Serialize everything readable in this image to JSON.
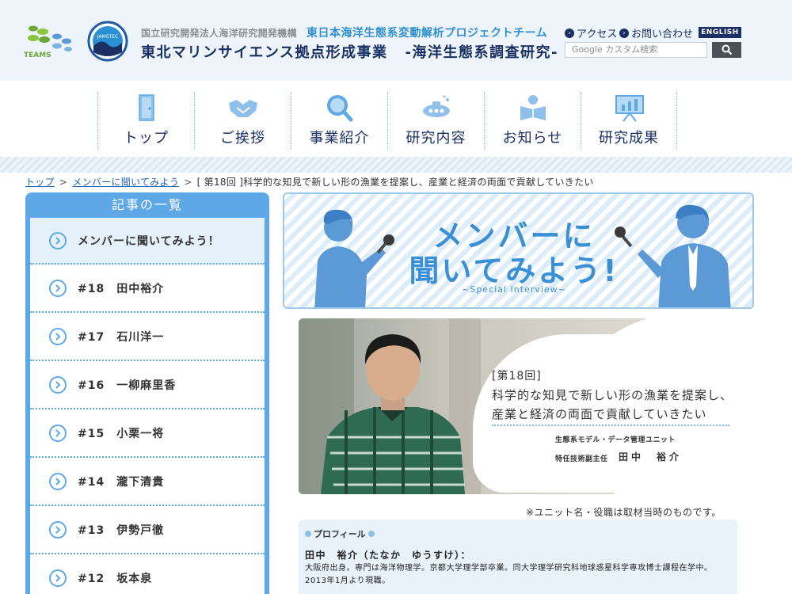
{
  "header": {
    "org_name": "国立研究開発法人海洋研究開発機構",
    "project_name": "東日本海洋生態系変動解析プロジェクトチーム",
    "site_title": "東北マリンサイエンス拠点形成事業",
    "site_subtitle": "-海洋生態系調査研究-",
    "logo_text": "TEAMS",
    "jamstec_text": "JAMSTEC",
    "access_label": "アクセス",
    "contact_label": "お問い合わせ",
    "english_label": "ENGLISH",
    "search_placeholder": "Google カスタム検索"
  },
  "nav": [
    {
      "label": "トップ",
      "icon": "door-icon"
    },
    {
      "label": "ご挨拶",
      "icon": "handshake-icon"
    },
    {
      "label": "事業紹介",
      "icon": "magnifier-icon"
    },
    {
      "label": "研究内容",
      "icon": "submarine-icon"
    },
    {
      "label": "お知らせ",
      "icon": "reader-icon"
    },
    {
      "label": "研究成果",
      "icon": "presentation-icon"
    }
  ],
  "breadcrumb": {
    "home": "トップ",
    "section": "メンバーに聞いてみよう",
    "current": "[ 第18回 ]科学的な知見で新しい形の漁業を提案し、産業と経済の両面で貢献していきたい"
  },
  "sidebar": {
    "title": "記事の一覧",
    "items": [
      {
        "label": "メンバーに聞いてみよう！"
      },
      {
        "label": "#18　田中裕介"
      },
      {
        "label": "#17　石川洋一"
      },
      {
        "label": "#16　一柳麻里香"
      },
      {
        "label": "#15　小栗一将"
      },
      {
        "label": "#14　瀧下清貴"
      },
      {
        "label": "#13　伊勢戸徹"
      },
      {
        "label": "#12　坂本泉"
      }
    ]
  },
  "banner": {
    "title_line1": "メンバーに",
    "title_line2": "聞いてみよう!",
    "subtitle": "~Special Interview~"
  },
  "interview": {
    "issue": "[第18回]",
    "headline_line1": "科学的な知見で新しい形の漁業を提案し、",
    "headline_line2": "産業と経済の両面で貢献していきたい",
    "unit": "生態系モデル・データ管理ユニット",
    "role": "特任技術副主任",
    "name": "田中　裕介"
  },
  "note": "※ユニット名・役職は取材当時のものです。",
  "profile": {
    "label": "プロフィール",
    "name": "田中　裕介（たなか　ゆうすけ）：",
    "text": "大阪府出身。専門は海洋物理学。京都大学理学部卒業。同大学理学研究科地球惑星科学専攻博士課程在学中。2013年1月より現職。"
  }
}
